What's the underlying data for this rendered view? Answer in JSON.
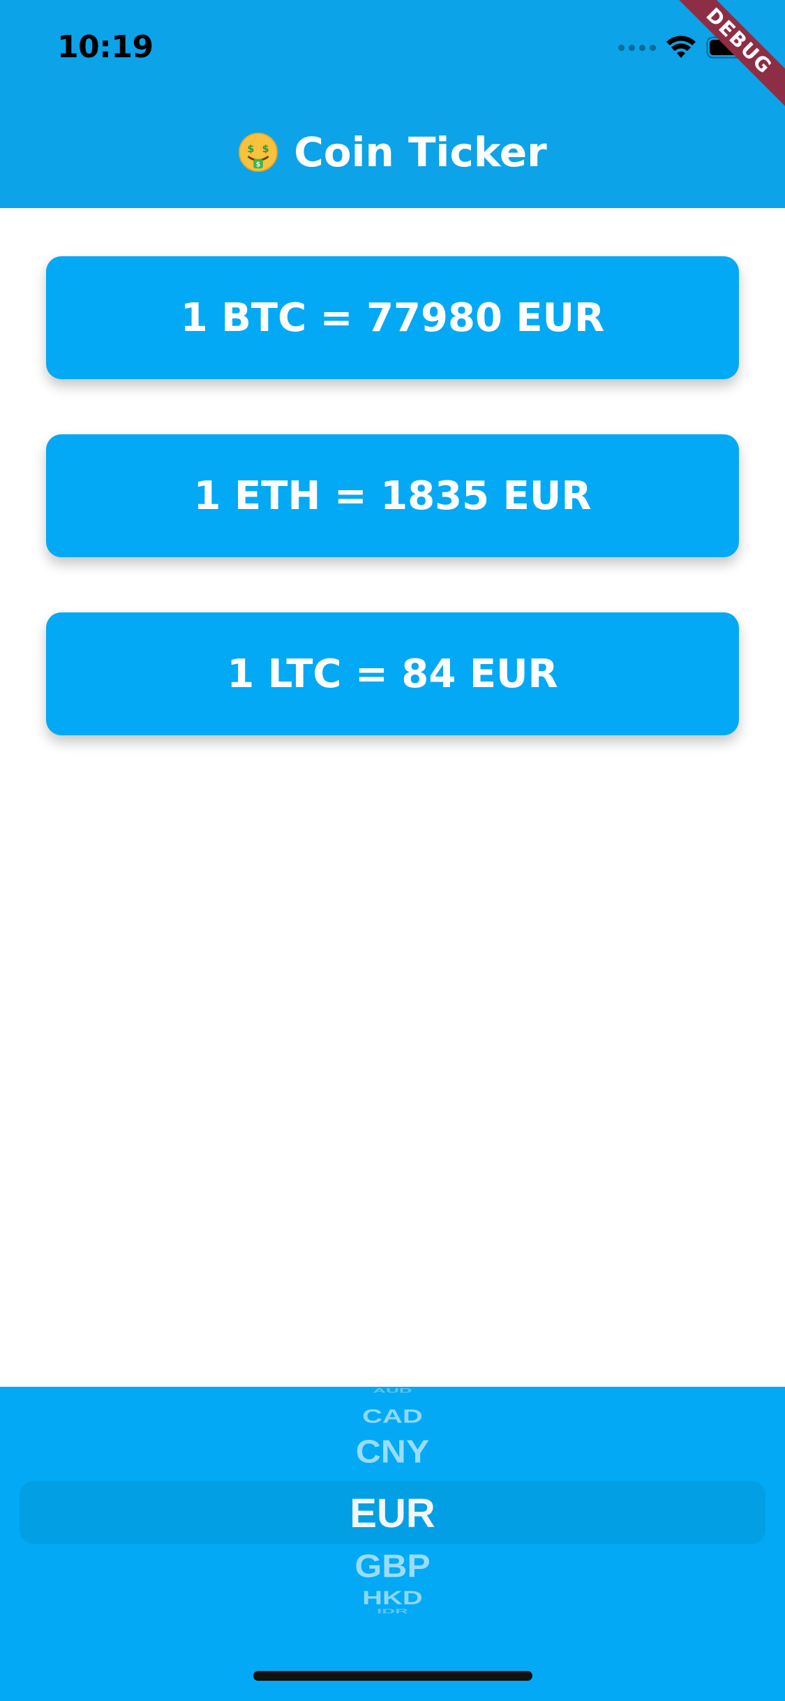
{
  "status_bar": {
    "time": "10:19"
  },
  "debug_banner": {
    "label": "DEBUG"
  },
  "app_bar": {
    "title": "Coin Ticker",
    "emoji_icon": "money-mouth-face-icon",
    "background_color": "#0ca3e8"
  },
  "rates": [
    {
      "coin": "BTC",
      "text": "1 BTC = 77980 EUR"
    },
    {
      "coin": "ETH",
      "text": "1 ETH = 1835 EUR"
    },
    {
      "coin": "LTC",
      "text": "1 LTC = 84 EUR"
    }
  ],
  "card_color": "#03a9f4",
  "picker": {
    "items": [
      "AUD",
      "CAD",
      "CNY",
      "EUR",
      "GBP",
      "HKD",
      "IDR"
    ],
    "selected": "EUR"
  }
}
